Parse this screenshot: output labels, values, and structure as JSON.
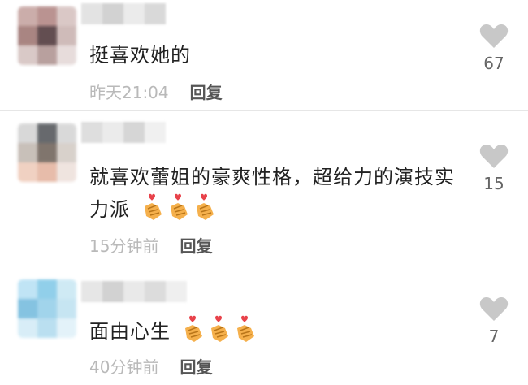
{
  "comments": [
    {
      "text": "挺喜欢她的",
      "time": "昨天21:04",
      "reply": "回复",
      "likes": "67",
      "heart_emojis": 0
    },
    {
      "text": "就喜欢蕾姐的豪爽性格，超给力的演技实力派",
      "time": "15分钟前",
      "reply": "回复",
      "likes": "15",
      "heart_emojis": 3
    },
    {
      "text": "面由心生",
      "time": "40分钟前",
      "reply": "回复",
      "likes": "7",
      "heart_emojis": 3
    }
  ],
  "icons": {
    "like": "heart-icon",
    "emoji": "finger-heart-emoji"
  },
  "colors": {
    "text": "#222222",
    "meta": "#b9b9b9",
    "reply": "#555555",
    "heart": "#c8c8c8"
  }
}
